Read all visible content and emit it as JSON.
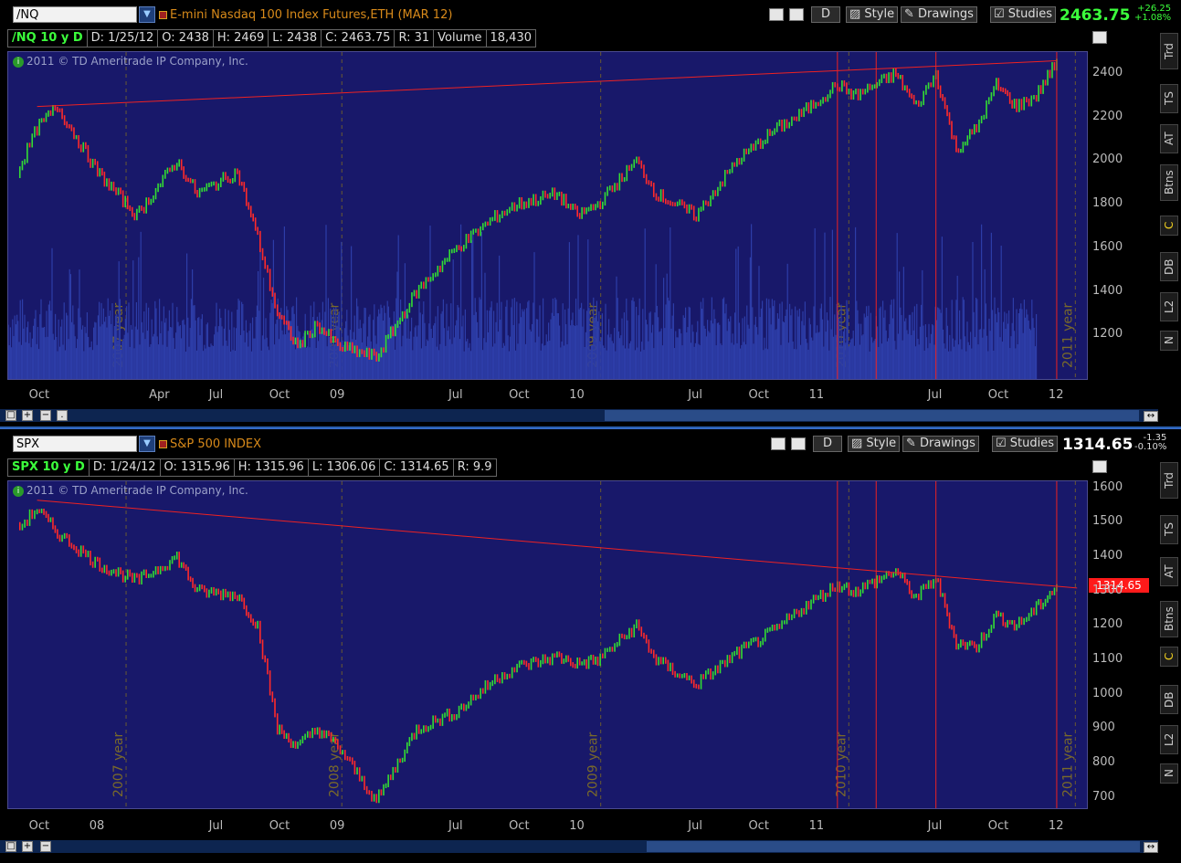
{
  "colors": {
    "up": "#33dd33",
    "down": "#ff2a2a",
    "plot_bg": "#18186a",
    "trend": "#ee2222",
    "volume": "#2d3da8",
    "year_label": "#7a6a2a"
  },
  "top": {
    "symbol": "/NQ",
    "description": "E-mini Nasdaq 100 Index Futures,ETH (MAR 12)",
    "buttons": {
      "period": "D",
      "style": "Style",
      "drawings": "Drawings",
      "studies": "Studies"
    },
    "price": "2463.75",
    "change": "+26.25",
    "change_pct": "+1.08%",
    "info": {
      "title": "/NQ 10 y D",
      "date": "D: 1/25/12",
      "open": "O: 2438",
      "high": "H: 2469",
      "low": "L: 2438",
      "close": "C: 2463.75",
      "range": "R: 31",
      "volume_label": "Volume",
      "volume_value": "18,430"
    },
    "copyright": "2011 © TD Ameritrade IP Company, Inc.",
    "y_ticks": [
      "2400",
      "2200",
      "2000",
      "1800",
      "1600",
      "1400",
      "1200"
    ],
    "x_ticks": [
      "Oct",
      "Apr",
      "Jul",
      "Oct",
      "09",
      "Jul",
      "Oct",
      "10",
      "Jul",
      "Oct",
      "11",
      "Jul",
      "Oct",
      "12"
    ],
    "year_labels": [
      "2007 year",
      "2008 year",
      "2009 year",
      "2010 year",
      "2011 year"
    ]
  },
  "bottom": {
    "symbol": "SPX",
    "description": "S&P 500 INDEX",
    "buttons": {
      "period": "D",
      "style": "Style",
      "drawings": "Drawings",
      "studies": "Studies"
    },
    "price": "1314.65",
    "change": "-1.35",
    "change_pct": "-0.10%",
    "info": {
      "title": "SPX 10 y D",
      "date": "D: 1/24/12",
      "open": "O: 1315.96",
      "high": "H: 1315.96",
      "low": "L: 1306.06",
      "close": "C: 1314.65",
      "range": "R: 9.9"
    },
    "copyright": "2011 © TD Ameritrade IP Company, Inc.",
    "last_badge": "1314.65",
    "y_ticks": [
      "1600",
      "1500",
      "1400",
      "1300",
      "1200",
      "1100",
      "1000",
      "900",
      "800",
      "700"
    ],
    "x_ticks": [
      "Oct",
      "08",
      "Jul",
      "Oct",
      "09",
      "Jul",
      "Oct",
      "10",
      "Jul",
      "Oct",
      "11",
      "Jul",
      "Oct",
      "12"
    ],
    "year_labels": [
      "2007 year",
      "2008 year",
      "2009 year",
      "2010 year",
      "2011 year"
    ]
  },
  "side_tabs": [
    "Trd",
    "TS",
    "AT",
    "Btns",
    "C",
    "DB",
    "L2",
    "N"
  ],
  "chart_data": [
    {
      "type": "line",
      "title": "/NQ 10 y D",
      "x": [
        "2007-09",
        "2007-10",
        "2007-11",
        "2008-01",
        "2008-03",
        "2008-05",
        "2008-06",
        "2008-08",
        "2008-09",
        "2008-10",
        "2008-11",
        "2008-12",
        "2009-01",
        "2009-03",
        "2009-05",
        "2009-07",
        "2009-09",
        "2009-10",
        "2009-12",
        "2010-01",
        "2010-02",
        "2010-04",
        "2010-05",
        "2010-07",
        "2010-09",
        "2010-11",
        "2010-12",
        "2011-02",
        "2011-03",
        "2011-05",
        "2011-06",
        "2011-07",
        "2011-08",
        "2011-09",
        "2011-10",
        "2011-11",
        "2011-12",
        "2012-01"
      ],
      "series": [
        {
          "values": [
            1950,
            2150,
            2250,
            1950,
            1750,
            2000,
            1850,
            1950,
            1650,
            1300,
            1150,
            1250,
            1150,
            1100,
            1400,
            1600,
            1750,
            1800,
            1850,
            1750,
            1800,
            2000,
            1850,
            1750,
            2000,
            2150,
            2200,
            2350,
            2300,
            2400,
            2250,
            2400,
            2050,
            2150,
            2350,
            2250,
            2300,
            2460
          ]
        }
      ],
      "ylim": [
        1000,
        2500
      ],
      "trendline": {
        "from": [
          "2007-10",
          2250
        ],
        "to": [
          "2012-01",
          2460
        ]
      },
      "vlines": [
        "2011-02",
        "2011-04",
        "2011-07",
        "2012-01"
      ]
    },
    {
      "type": "line",
      "title": "SPX 10 y D",
      "x": [
        "2007-09",
        "2007-10",
        "2007-11",
        "2008-01",
        "2008-03",
        "2008-05",
        "2008-06",
        "2008-08",
        "2008-09",
        "2008-10",
        "2008-11",
        "2008-12",
        "2009-01",
        "2009-03",
        "2009-05",
        "2009-07",
        "2009-09",
        "2009-10",
        "2009-12",
        "2010-01",
        "2010-02",
        "2010-04",
        "2010-05",
        "2010-07",
        "2010-09",
        "2010-11",
        "2010-12",
        "2011-02",
        "2011-03",
        "2011-05",
        "2011-06",
        "2011-07",
        "2011-08",
        "2011-09",
        "2011-10",
        "2011-11",
        "2011-12",
        "2012-01"
      ],
      "series": [
        {
          "values": [
            1480,
            1540,
            1470,
            1380,
            1330,
            1400,
            1300,
            1290,
            1200,
            900,
            850,
            900,
            850,
            690,
            900,
            950,
            1050,
            1080,
            1110,
            1090,
            1100,
            1200,
            1100,
            1030,
            1120,
            1190,
            1240,
            1320,
            1300,
            1360,
            1280,
            1340,
            1150,
            1140,
            1230,
            1200,
            1250,
            1315
          ]
        }
      ],
      "ylim": [
        670,
        1620
      ],
      "trendline": {
        "from": [
          "2007-10",
          1565
        ],
        "to": [
          "2012-02",
          1310
        ]
      },
      "vlines": [
        "2011-02",
        "2011-04",
        "2011-07",
        "2012-01"
      ]
    }
  ]
}
